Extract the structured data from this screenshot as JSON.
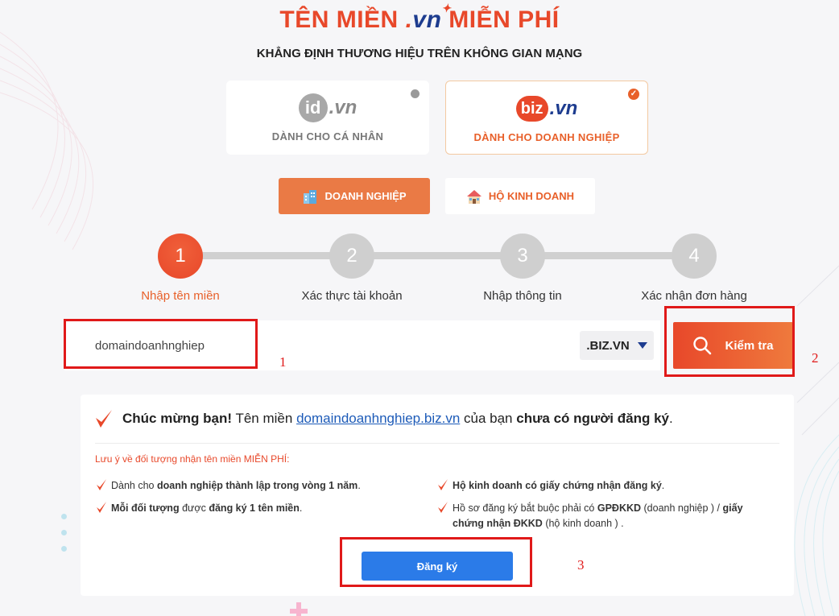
{
  "header": {
    "title_prefix": "TÊN MIỀN",
    "title_brand_dot": ".",
    "title_brand": "vn",
    "title_suffix": "MIỄN PHÍ",
    "subtitle": "KHẲNG ĐỊNH THƯƠNG HIỆU TRÊN KHÔNG GIAN MẠNG"
  },
  "products": [
    {
      "logo_left": "id",
      "logo_right": ".vn",
      "label": "DÀNH CHO CÁ NHÂN",
      "selected": false
    },
    {
      "logo_left": "biz",
      "logo_right": ".vn",
      "label": "DÀNH CHO DOANH NGHIỆP",
      "selected": true
    }
  ],
  "type_tabs": [
    {
      "label": "DOANH NGHIỆP",
      "active": true,
      "icon": "building-icon"
    },
    {
      "label": "HỘ KINH DOANH",
      "active": false,
      "icon": "house-icon"
    }
  ],
  "steps": [
    {
      "number": "1",
      "label": "Nhập tên miền",
      "active": true
    },
    {
      "number": "2",
      "label": "Xác thực tài khoản",
      "active": false
    },
    {
      "number": "3",
      "label": "Nhập thông tin",
      "active": false
    },
    {
      "number": "4",
      "label": "Xác nhận đơn hàng",
      "active": false
    }
  ],
  "search": {
    "value": "domaindoanhnghiep",
    "tld": ".BIZ.VN",
    "button_label": "Kiểm tra"
  },
  "annotations": [
    "1",
    "2",
    "3"
  ],
  "result": {
    "congrats_strong": "Chúc mừng bạn!",
    "text_before_link": "Tên miền",
    "domain_link": "domaindoanhnghiep.biz.vn",
    "text_after_link": "của bạn",
    "status_strong": "chưa có người đăng ký",
    "end": ".",
    "note_title": "Lưu ý về đối tượng nhận tên miền",
    "note_title_free": "MIỄN PHÍ:",
    "bullets": [
      {
        "pre": "Dành cho",
        "bold": "doanh nghiệp thành lập trong vòng 1 năm",
        "post": "."
      },
      {
        "pre": "",
        "bold": "Hộ kinh doanh có giấy chứng nhận đăng ký",
        "post": "."
      },
      {
        "bold1": "Mỗi đối tượng",
        "mid": "được",
        "bold2": "đăng ký 1 tên miền",
        "post": "."
      },
      {
        "pre": "Hồ sơ đăng ký bắt buộc phải có",
        "bold1": "GPĐKKD",
        "mid": "(doanh nghiệp ) /",
        "bold2": "giấy chứng nhận ĐKKD",
        "post": "(hộ kinh doanh ) ."
      }
    ],
    "register_label": "Đăng ký"
  },
  "colors": {
    "brand_red": "#e8482a",
    "brand_orange": "#ea7a45",
    "brand_blue": "#1d3c8f",
    "button_blue": "#2b7be8",
    "annotation_red": "#e01919"
  }
}
